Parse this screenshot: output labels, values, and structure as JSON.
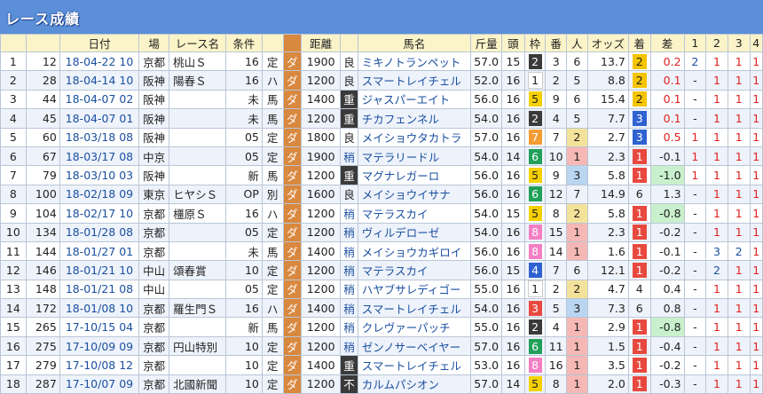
{
  "title": "レース成績",
  "headers": [
    "",
    "",
    "日付",
    "場",
    "レース名",
    "条件",
    "",
    "",
    "距離",
    "",
    "馬名",
    "斤量",
    "頭",
    "枠",
    "番",
    "人",
    "オッズ",
    "着",
    "差",
    "1",
    "2",
    "3",
    "4"
  ],
  "colors": {
    "waku": {
      "1": "#ffffff",
      "2": "#3a3a3a",
      "3": "#e8493f",
      "4": "#2f62d0",
      "5": "#f5d000",
      "6": "#21a05a",
      "7": "#f39c34",
      "8": "#f47fc4"
    },
    "finish": {
      "1": "#e8493f",
      "2": "#f5c400",
      "3": "#2f62d0",
      "other": "#ffffff"
    },
    "ninki": {
      "1": "#f5b8b4",
      "2": "#f5e29a",
      "3": "#b9d5f0"
    }
  },
  "rows": [
    {
      "no": "1",
      "id": "12",
      "date": "18-04-22 10",
      "venue": "京都",
      "race": "桃山Ｓ",
      "cond": "16",
      "tag": "定",
      "surf": "ダ",
      "dist": "1900",
      "track": "良",
      "horse": "ミキノトランペット",
      "kin": "57.0",
      "heads": "15",
      "waku": "2",
      "ban": "3",
      "ninki": "6",
      "odds": "13.7",
      "chaku": "2",
      "sa": "0.2",
      "p1": "2",
      "p2": "1",
      "p3": "1",
      "p4": "1"
    },
    {
      "no": "2",
      "id": "28",
      "date": "18-04-14 10",
      "venue": "阪神",
      "race": "陽春Ｓ",
      "cond": "16",
      "tag": "ハ",
      "surf": "ダ",
      "dist": "1200",
      "track": "良",
      "horse": "スマートレイチェル",
      "kin": "52.0",
      "heads": "16",
      "waku": "1",
      "ban": "2",
      "ninki": "5",
      "odds": "8.8",
      "chaku": "2",
      "sa": "0.1",
      "p1": "-",
      "p2": "1",
      "p3": "1",
      "p4": "1"
    },
    {
      "no": "3",
      "id": "44",
      "date": "18-04-07 02",
      "venue": "阪神",
      "race": "",
      "cond": "未",
      "tag": "馬",
      "surf": "ダ",
      "dist": "1400",
      "track": "重",
      "horse": "ジャスパーエイト",
      "kin": "56.0",
      "heads": "16",
      "waku": "5",
      "ban": "9",
      "ninki": "6",
      "odds": "15.4",
      "chaku": "2",
      "sa": "0.1",
      "p1": "-",
      "p2": "1",
      "p3": "1",
      "p4": "1"
    },
    {
      "no": "4",
      "id": "45",
      "date": "18-04-07 01",
      "venue": "阪神",
      "race": "",
      "cond": "未",
      "tag": "馬",
      "surf": "ダ",
      "dist": "1200",
      "track": "重",
      "horse": "チカフェンネル",
      "kin": "54.0",
      "heads": "16",
      "waku": "2",
      "ban": "4",
      "ninki": "5",
      "odds": "7.7",
      "chaku": "3",
      "sa": "0.1",
      "p1": "-",
      "p2": "1",
      "p3": "1",
      "p4": "1"
    },
    {
      "no": "5",
      "id": "60",
      "date": "18-03/18 08",
      "venue": "阪神",
      "race": "",
      "cond": "05",
      "tag": "定",
      "surf": "ダ",
      "dist": "1800",
      "track": "良",
      "horse": "メイショウタカトラ",
      "kin": "57.0",
      "heads": "16",
      "waku": "7",
      "ban": "7",
      "ninki": "2",
      "odds": "2.7",
      "chaku": "3",
      "sa": "0.5",
      "p1": "1",
      "p2": "1",
      "p3": "1",
      "p4": "1"
    },
    {
      "no": "6",
      "id": "67",
      "date": "18-03/17 08",
      "venue": "中京",
      "race": "",
      "cond": "05",
      "tag": "定",
      "surf": "ダ",
      "dist": "1900",
      "track": "稍",
      "horse": "マテラリードル",
      "kin": "54.0",
      "heads": "14",
      "waku": "6",
      "ban": "10",
      "ninki": "1",
      "odds": "2.3",
      "chaku": "1",
      "sa": "-0.1",
      "p1": "1",
      "p2": "1",
      "p3": "1",
      "p4": "1"
    },
    {
      "no": "7",
      "id": "79",
      "date": "18-03/10 03",
      "venue": "阪神",
      "race": "",
      "cond": "新",
      "tag": "馬",
      "surf": "ダ",
      "dist": "1200",
      "track": "重",
      "horse": "マグナレガーロ",
      "kin": "56.0",
      "heads": "16",
      "waku": "5",
      "ban": "9",
      "ninki": "3",
      "odds": "5.8",
      "chaku": "1",
      "sa": "-1.0",
      "p1": "1",
      "p2": "1",
      "p3": "1",
      "p4": "1"
    },
    {
      "no": "8",
      "id": "100",
      "date": "18-02/18 09",
      "venue": "東京",
      "race": "ヒヤシＳ",
      "cond": "OP",
      "tag": "別",
      "surf": "ダ",
      "dist": "1600",
      "track": "良",
      "horse": "メイショウイサナ",
      "kin": "56.0",
      "heads": "16",
      "waku": "6",
      "ban": "12",
      "ninki": "7",
      "odds": "14.9",
      "chaku": "6",
      "sa": "1.3",
      "p1": "-",
      "p2": "1",
      "p3": "1",
      "p4": "1"
    },
    {
      "no": "9",
      "id": "104",
      "date": "18-02/17 10",
      "venue": "京都",
      "race": "橿原Ｓ",
      "cond": "16",
      "tag": "ハ",
      "surf": "ダ",
      "dist": "1200",
      "track": "稍",
      "horse": "マテラスカイ",
      "kin": "54.0",
      "heads": "15",
      "waku": "5",
      "ban": "8",
      "ninki": "2",
      "odds": "5.8",
      "chaku": "1",
      "sa": "-0.8",
      "p1": "-",
      "p2": "1",
      "p3": "1",
      "p4": "1"
    },
    {
      "no": "10",
      "id": "134",
      "date": "18-01/28 08",
      "venue": "京都",
      "race": "",
      "cond": "05",
      "tag": "定",
      "surf": "ダ",
      "dist": "1200",
      "track": "稍",
      "horse": "ヴィルデローゼ",
      "kin": "54.0",
      "heads": "16",
      "waku": "8",
      "ban": "15",
      "ninki": "1",
      "odds": "2.3",
      "chaku": "1",
      "sa": "-0.2",
      "p1": "-",
      "p2": "1",
      "p3": "1",
      "p4": "1"
    },
    {
      "no": "11",
      "id": "144",
      "date": "18-01/27 01",
      "venue": "京都",
      "race": "",
      "cond": "未",
      "tag": "馬",
      "surf": "ダ",
      "dist": "1400",
      "track": "稍",
      "horse": "メイショウカギロイ",
      "kin": "56.0",
      "heads": "16",
      "waku": "8",
      "ban": "14",
      "ninki": "1",
      "odds": "1.6",
      "chaku": "1",
      "sa": "-0.1",
      "p1": "-",
      "p2": "3",
      "p3": "2",
      "p4": "1"
    },
    {
      "no": "12",
      "id": "146",
      "date": "18-01/21 10",
      "venue": "中山",
      "race": "頌春賞",
      "cond": "10",
      "tag": "定",
      "surf": "ダ",
      "dist": "1200",
      "track": "稍",
      "horse": "マテラスカイ",
      "kin": "56.0",
      "heads": "15",
      "waku": "4",
      "ban": "7",
      "ninki": "6",
      "odds": "12.1",
      "chaku": "1",
      "sa": "-0.2",
      "p1": "-",
      "p2": "2",
      "p3": "1",
      "p4": "1"
    },
    {
      "no": "13",
      "id": "148",
      "date": "18-01/21 08",
      "venue": "中山",
      "race": "",
      "cond": "05",
      "tag": "定",
      "surf": "ダ",
      "dist": "1200",
      "track": "稍",
      "horse": "ハヤブサレディゴー",
      "kin": "55.0",
      "heads": "16",
      "waku": "1",
      "ban": "2",
      "ninki": "2",
      "odds": "4.7",
      "chaku": "4",
      "sa": "0.4",
      "p1": "-",
      "p2": "1",
      "p3": "1",
      "p4": "1"
    },
    {
      "no": "14",
      "id": "172",
      "date": "18-01/08 10",
      "venue": "京都",
      "race": "羅生門Ｓ",
      "cond": "16",
      "tag": "ハ",
      "surf": "ダ",
      "dist": "1400",
      "track": "稍",
      "horse": "スマートレイチェル",
      "kin": "54.0",
      "heads": "16",
      "waku": "3",
      "ban": "5",
      "ninki": "3",
      "odds": "7.3",
      "chaku": "6",
      "sa": "0.8",
      "p1": "-",
      "p2": "1",
      "p3": "1",
      "p4": "1"
    },
    {
      "no": "15",
      "id": "265",
      "date": "17-10/15 04",
      "venue": "京都",
      "race": "",
      "cond": "新",
      "tag": "馬",
      "surf": "ダ",
      "dist": "1200",
      "track": "稍",
      "horse": "クレヴァーパッチ",
      "kin": "55.0",
      "heads": "16",
      "waku": "2",
      "ban": "4",
      "ninki": "1",
      "odds": "2.9",
      "chaku": "1",
      "sa": "-0.8",
      "p1": "-",
      "p2": "1",
      "p3": "1",
      "p4": "1"
    },
    {
      "no": "16",
      "id": "275",
      "date": "17-10/09 09",
      "venue": "京都",
      "race": "円山特別",
      "cond": "10",
      "tag": "定",
      "surf": "ダ",
      "dist": "1200",
      "track": "稍",
      "horse": "ゼンノサーベイヤー",
      "kin": "57.0",
      "heads": "16",
      "waku": "6",
      "ban": "11",
      "ninki": "1",
      "odds": "1.5",
      "chaku": "1",
      "sa": "-0.4",
      "p1": "-",
      "p2": "1",
      "p3": "1",
      "p4": "1"
    },
    {
      "no": "17",
      "id": "279",
      "date": "17-10/08 12",
      "venue": "京都",
      "race": "",
      "cond": "10",
      "tag": "定",
      "surf": "ダ",
      "dist": "1400",
      "track": "重",
      "horse": "スマートレイチェル",
      "kin": "53.0",
      "heads": "16",
      "waku": "8",
      "ban": "16",
      "ninki": "1",
      "odds": "3.5",
      "chaku": "1",
      "sa": "-0.2",
      "p1": "-",
      "p2": "1",
      "p3": "1",
      "p4": "1"
    },
    {
      "no": "18",
      "id": "287",
      "date": "17-10/07 09",
      "venue": "京都",
      "race": "北國新聞",
      "cond": "10",
      "tag": "定",
      "surf": "ダ",
      "dist": "1200",
      "track": "不",
      "horse": "カルムパシオン",
      "kin": "57.0",
      "heads": "14",
      "waku": "5",
      "ban": "8",
      "ninki": "1",
      "odds": "2.0",
      "chaku": "1",
      "sa": "-0.3",
      "p1": "-",
      "p2": "1",
      "p3": "1",
      "p4": "1"
    }
  ]
}
